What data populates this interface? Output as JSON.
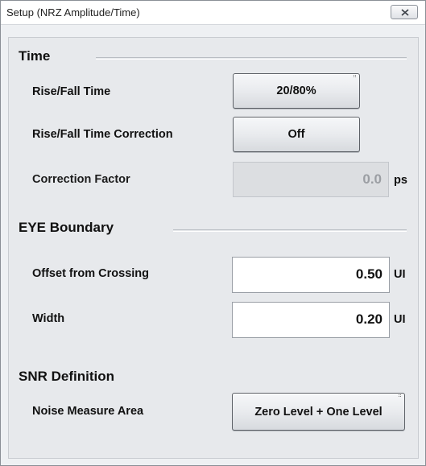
{
  "window": {
    "title": "Setup (NRZ Amplitude/Time)"
  },
  "time_section": {
    "title": "Time",
    "rise_fall_time_label": "Rise/Fall Time",
    "rise_fall_time_value": "20/80%",
    "rise_fall_correction_label": "Rise/Fall Time Correction",
    "rise_fall_correction_value": "Off",
    "correction_factor_label": "Correction Factor",
    "correction_factor_value": "0.0",
    "correction_factor_unit": "ps"
  },
  "eye_section": {
    "title": "EYE Boundary",
    "offset_label": "Offset from Crossing",
    "offset_value": "0.50",
    "offset_unit": "UI",
    "width_label": "Width",
    "width_value": "0.20",
    "width_unit": "UI"
  },
  "snr_section": {
    "title": "SNR Definition",
    "noise_area_label": "Noise Measure Area",
    "noise_area_value": "Zero Level + One Level"
  }
}
